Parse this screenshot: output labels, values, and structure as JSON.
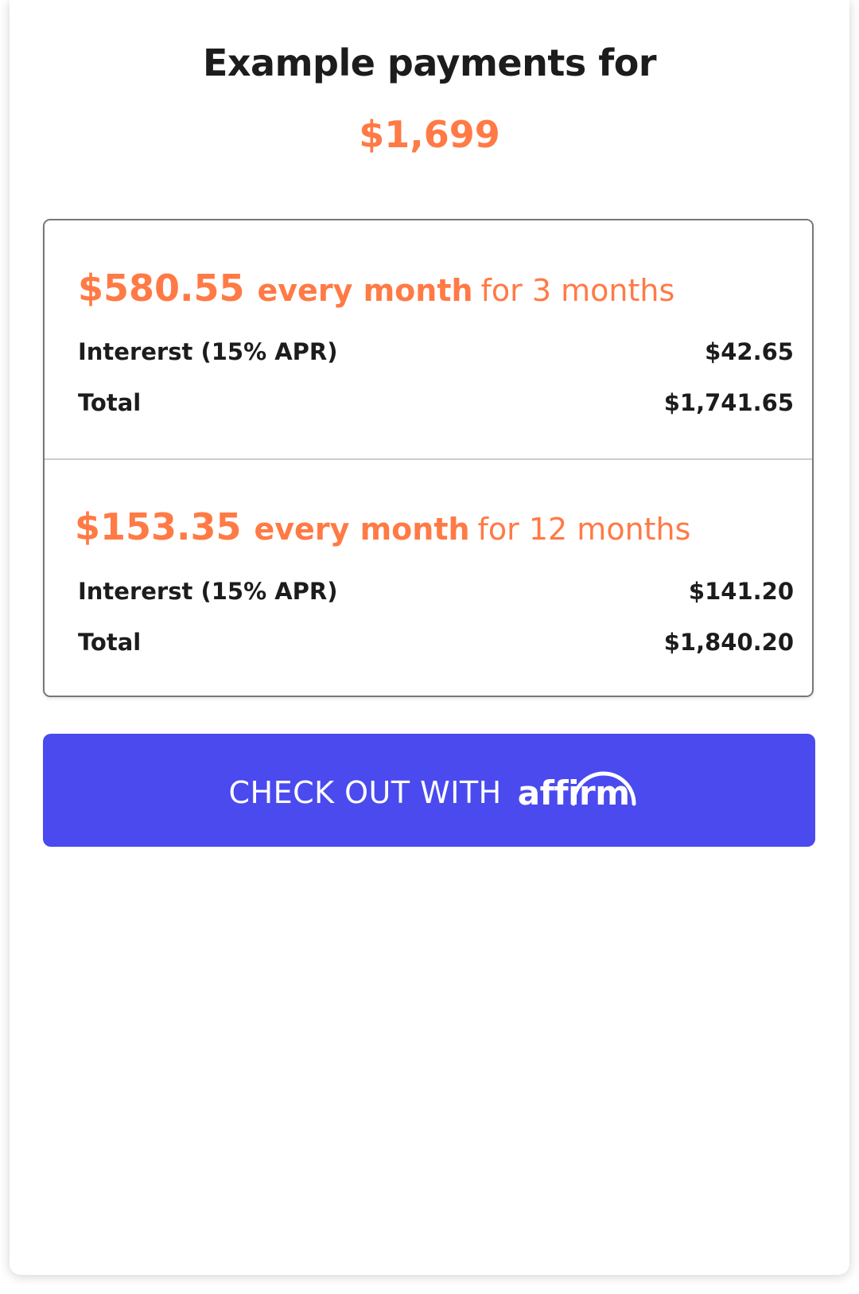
{
  "header": {
    "title": "Example payments for",
    "amount": "$1,699"
  },
  "plans": [
    {
      "monthly_payment": "$580.55",
      "frequency": "every month",
      "term": "for 3 months",
      "interest_label": "Intererst (15% APR)",
      "interest_value": "$42.65",
      "total_label": "Total",
      "total_value": "$1,741.65"
    },
    {
      "monthly_payment": "$153.35",
      "frequency": "every month",
      "term": "for 12 months",
      "interest_label": "Intererst (15% APR)",
      "interest_value": "$141.20",
      "total_label": "Total",
      "total_value": "$1,840.20"
    }
  ],
  "checkout": {
    "label": "CHECK OUT WITH",
    "brand": "affirm",
    "button_color": "#4a4aef"
  },
  "colors": {
    "accent": "#ff7a45",
    "text": "#1c1c1c"
  }
}
